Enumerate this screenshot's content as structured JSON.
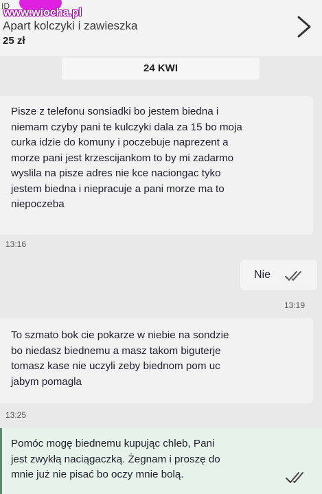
{
  "header": {
    "id_label": "ID",
    "watermark": "www.wiocha.pl",
    "product_name": "Apart kolczyki i zawieszka",
    "product_price": "25 zł"
  },
  "date_separator": "24 KWI",
  "messages": [
    {
      "direction": "incoming",
      "text": "Pisze z telefonu sonsiadki bo jestem biedna i\nniemam czyby pani te kulczyki dala za 15 bo moja\ncurka idzie do komuny i poczebuje naprezent a\nmorze pani jest krzescijankom to by mi zadarmo\nwyslila na pisze adres nie kce naciongac tyko\njestem biedna i niepracuje a pani morze ma to\nniepoczeba",
      "time": "13:16"
    },
    {
      "direction": "outgoing",
      "text": "Nie",
      "time": "13:19",
      "status_icon": "double-check-icon"
    },
    {
      "direction": "incoming",
      "text": "To szmato bok cie pokarze w niebie na sondzie\nbo niedasz biednemu a masz takom biguterje\ntomasz kase nie uczyli zeby biednom pom uc\njabym pomagla",
      "time": "13:25"
    },
    {
      "direction": "outgoing",
      "text": "Pomóc mogę biednemu kupując chleb, Pani\njest zwykłą naciągaczką. Żegnam i proszę do\nmnie już nie pisać bo oczy mnie bolą.",
      "status_icon": "double-check-icon"
    }
  ],
  "colors": {
    "background": "#e9e9e9",
    "bubble": "#f2f2f2",
    "outgoing_highlight": "#e6f2ea",
    "watermark_outline": "#b000b0",
    "tick": "#555555"
  }
}
